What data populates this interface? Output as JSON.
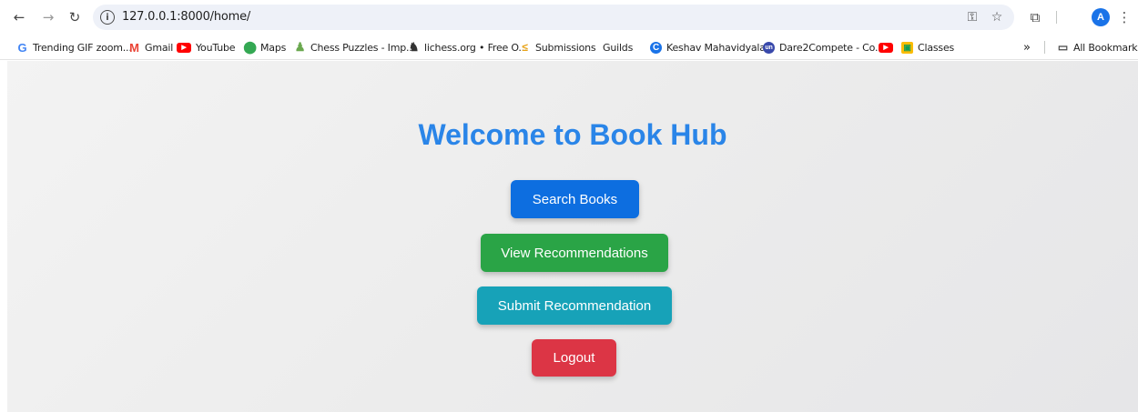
{
  "browser": {
    "url": "127.0.0.1:8000/home/",
    "bookmarks": [
      {
        "label": "Trending GIF zoom...",
        "icon": "google-icon"
      },
      {
        "label": "Gmail",
        "icon": "gmail-icon"
      },
      {
        "label": "YouTube",
        "icon": "youtube-icon"
      },
      {
        "label": "Maps",
        "icon": "maps-icon"
      },
      {
        "label": "Chess Puzzles - Imp...",
        "icon": "chess-icon"
      },
      {
        "label": "lichess.org • Free O...",
        "icon": "lichess-icon"
      },
      {
        "label": "Submissions",
        "icon": "submissions-icon"
      },
      {
        "label": "Guilds",
        "icon": ""
      },
      {
        "label": "Keshav Mahavidyala...",
        "icon": "keshav-icon"
      },
      {
        "label": "Dare2Compete - Co...",
        "icon": "dare2compete-icon"
      },
      {
        "label": "",
        "icon": "youtube-icon"
      },
      {
        "label": "Classes",
        "icon": "classroom-icon"
      }
    ],
    "more_glyph": "»",
    "all_bookmarks": "All Bookmarks",
    "profile_initial": "A",
    "d2c_badge": "un"
  },
  "page": {
    "title": "Welcome to Book Hub",
    "buttons": {
      "search": "Search Books",
      "view": "View Recommendations",
      "submit": "Submit Recommendation",
      "logout": "Logout"
    }
  },
  "colors": {
    "title": "#2a85e8",
    "search": "#0d6ee0",
    "view": "#2aa446",
    "submit": "#17a2b8",
    "logout": "#dc3545"
  }
}
